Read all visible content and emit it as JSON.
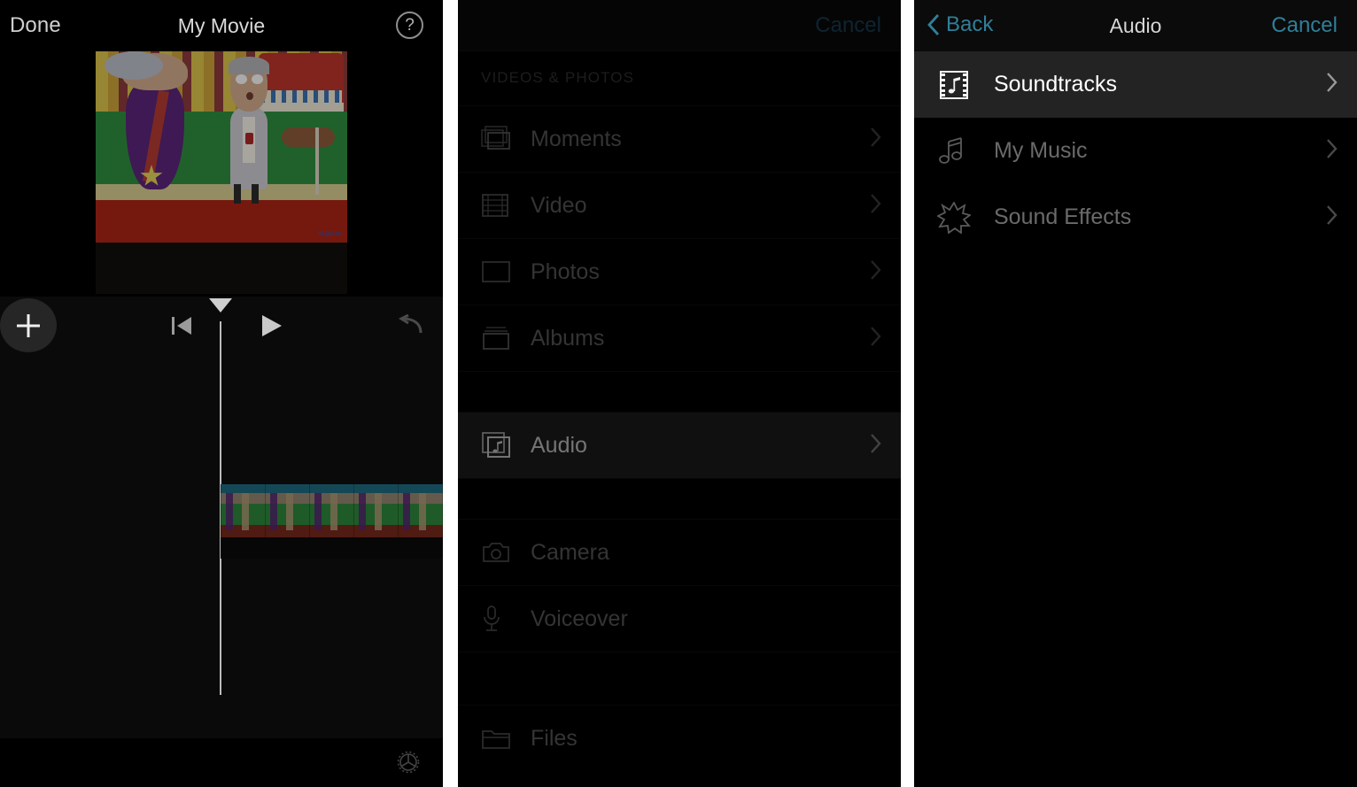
{
  "left_panel": {
    "topbar": {
      "done_label": "Done",
      "title": "My Movie",
      "help_icon": "?"
    },
    "viewer": {
      "watermark": "vt.pn.ru"
    },
    "toolbar": {
      "add_icon": "plus-icon",
      "skip_back_icon": "skip-to-start-icon",
      "play_icon": "play-icon",
      "undo_icon": "undo-icon"
    },
    "timeline": {
      "playhead_icon": "playhead-marker",
      "clip_label": ""
    },
    "bottombar": {
      "settings_icon": "gear-icon"
    }
  },
  "middle_panel": {
    "topbar": {
      "cancel_label": "Cancel"
    },
    "section_header": "VIDEOS & PHOTOS",
    "items": [
      {
        "label": "Moments",
        "icon": "moments-icon",
        "chevron": "›",
        "selected": false
      },
      {
        "label": "Video",
        "icon": "film-icon",
        "chevron": "›",
        "selected": false
      },
      {
        "label": "Photos",
        "icon": "photo-icon",
        "chevron": "›",
        "selected": false
      },
      {
        "label": "Albums",
        "icon": "albums-icon",
        "chevron": "›",
        "selected": false
      },
      {
        "label": "Audio",
        "icon": "audio-icon",
        "chevron": "›",
        "selected": true
      },
      {
        "label": "Camera",
        "icon": "camera-icon",
        "chevron": "",
        "selected": false
      },
      {
        "label": "Voiceover",
        "icon": "microphone-icon",
        "chevron": "",
        "selected": false
      },
      {
        "label": "Files",
        "icon": "folder-icon",
        "chevron": "",
        "selected": false
      }
    ]
  },
  "right_panel": {
    "topbar": {
      "back_label": "Back",
      "title": "Audio",
      "cancel_label": "Cancel"
    },
    "items": [
      {
        "label": "Soundtracks",
        "icon": "soundtrack-film-note-icon",
        "chevron": "›",
        "selected": true
      },
      {
        "label": "My Music",
        "icon": "music-note-icon",
        "chevron": "›",
        "selected": false
      },
      {
        "label": "Sound Effects",
        "icon": "starburst-icon",
        "chevron": "›",
        "selected": false
      }
    ]
  },
  "colors": {
    "panel_background": "#000000",
    "row_highlight": "#232323",
    "accent_blue": "#2f7f99",
    "accent_blue_dim": "#1f4d66",
    "label_dim": "#6e6e6e",
    "label_bright": "#f2f2f2"
  }
}
